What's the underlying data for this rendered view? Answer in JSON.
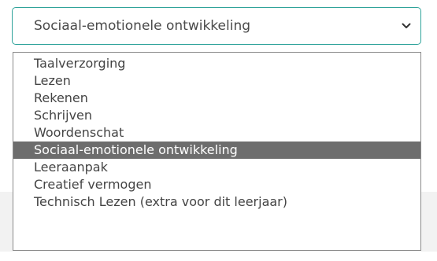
{
  "select": {
    "value": "Sociaal-emotionele ontwikkeling",
    "accent_color": "#2fa39a",
    "icon": "chevron-down-icon"
  },
  "dropdown": {
    "options": [
      "Taalverzorging",
      "Lezen",
      "Rekenen",
      "Schrijven",
      "Woordenschat",
      "Sociaal-emotionele ontwikkeling",
      "Leeraanpak",
      "Creatief vermogen",
      "Technisch Lezen (extra voor dit leerjaar)"
    ],
    "selected_index": 5,
    "highlight_color": "#6d6d6d"
  }
}
